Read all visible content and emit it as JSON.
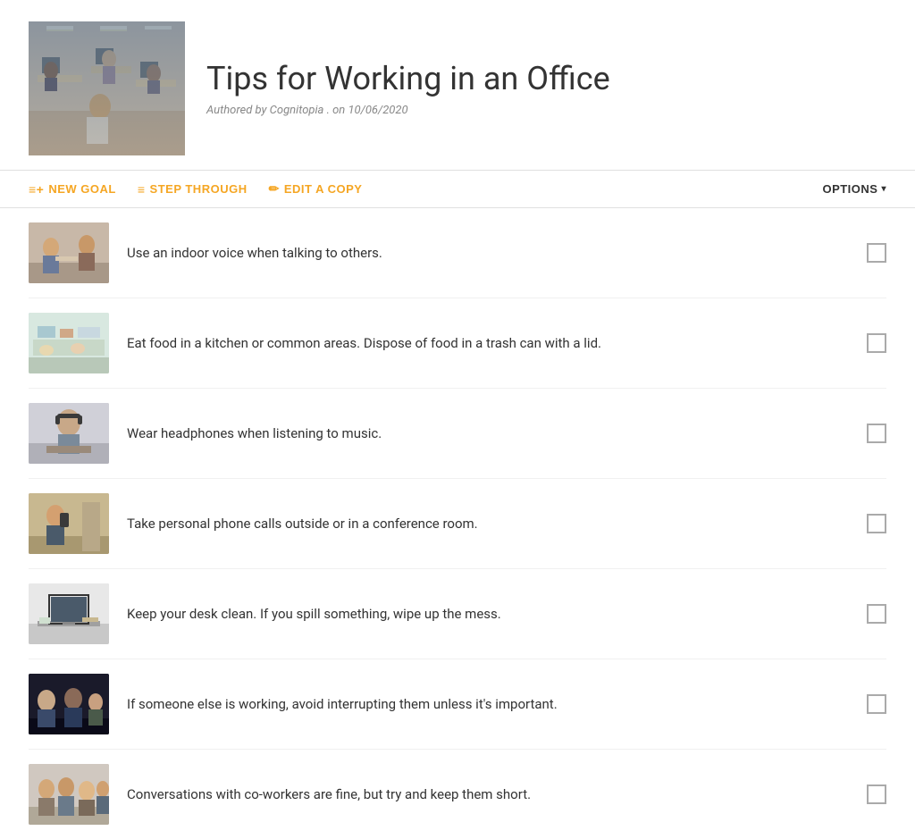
{
  "header": {
    "title": "Tips for Working in an Office",
    "author": "Authored by Cognitopia . on 10/06/2020"
  },
  "toolbar": {
    "new_goal_label": "NEW GOAL",
    "step_through_label": "STEP THROUGH",
    "edit_copy_label": "EDIT A COPY",
    "options_label": "OPTIONS"
  },
  "steps": [
    {
      "id": 1,
      "text": "Use an indoor voice when talking to others.",
      "img_class": "img-1"
    },
    {
      "id": 2,
      "text": "Eat food in a kitchen or common areas. Dispose of food in a trash can with a lid.",
      "img_class": "img-2"
    },
    {
      "id": 3,
      "text": "Wear headphones when listening to music.",
      "img_class": "img-3"
    },
    {
      "id": 4,
      "text": "Take personal phone calls outside or in a conference room.",
      "img_class": "img-4"
    },
    {
      "id": 5,
      "text": "Keep your desk clean. If you spill something, wipe up the mess.",
      "img_class": "img-5"
    },
    {
      "id": 6,
      "text": "If someone else is working, avoid interrupting them unless it's important.",
      "img_class": "img-6"
    },
    {
      "id": 7,
      "text": "Conversations with co-workers are fine, but try and keep them short.",
      "img_class": "img-7"
    }
  ]
}
